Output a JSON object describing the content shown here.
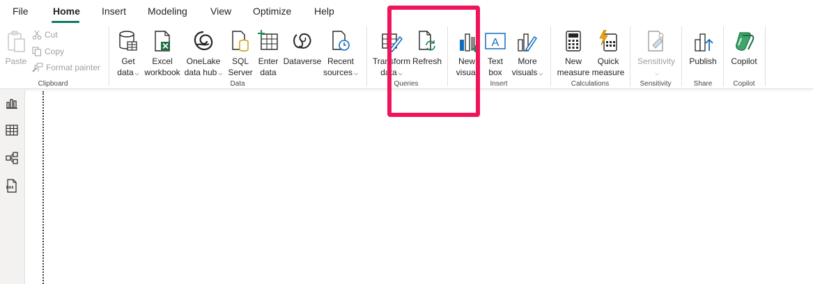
{
  "menu": {
    "tabs": [
      {
        "label": "File"
      },
      {
        "label": "Home"
      },
      {
        "label": "Insert"
      },
      {
        "label": "Modeling"
      },
      {
        "label": "View"
      },
      {
        "label": "Optimize"
      },
      {
        "label": "Help"
      }
    ],
    "active_tab": "Home"
  },
  "ribbon": {
    "clipboard": {
      "paste": "Paste",
      "cut": "Cut",
      "copy": "Copy",
      "format_painter": "Format painter",
      "group": "Clipboard"
    },
    "data": {
      "get_data": [
        "Get",
        "data"
      ],
      "excel": [
        "Excel",
        "workbook"
      ],
      "onelake": [
        "OneLake",
        "data hub"
      ],
      "sql": [
        "SQL",
        "Server"
      ],
      "enter": [
        "Enter",
        "data"
      ],
      "dataverse": [
        "Dataverse"
      ],
      "recent": [
        "Recent",
        "sources"
      ],
      "group": "Data"
    },
    "queries": {
      "transform": [
        "Transform",
        "data"
      ],
      "refresh": [
        "Refresh"
      ],
      "group": "Queries"
    },
    "insert": {
      "new_visual": [
        "New",
        "visual"
      ],
      "text_box": [
        "Text",
        "box"
      ],
      "more_visuals": [
        "More",
        "visuals"
      ],
      "group": "Insert"
    },
    "calculations": {
      "new_measure": [
        "New",
        "measure"
      ],
      "quick_measure": [
        "Quick",
        "measure"
      ],
      "group": "Calculations"
    },
    "sensitivity": {
      "sensitivity": [
        "Sensitivity"
      ],
      "group": "Sensitivity"
    },
    "share": {
      "publish": [
        "Publish"
      ],
      "group": "Share"
    },
    "copilot": {
      "copilot": [
        "Copilot"
      ],
      "group": "Copilot"
    }
  },
  "rail": {
    "items": [
      {
        "icon": "report-view-icon"
      },
      {
        "icon": "table-view-icon"
      },
      {
        "icon": "model-view-icon"
      },
      {
        "icon": "dax-query-view-icon",
        "label": "DAX"
      }
    ]
  },
  "colors": {
    "accent": "#117865",
    "highlight": "#f0145a",
    "disabled": "#a19f9d"
  }
}
